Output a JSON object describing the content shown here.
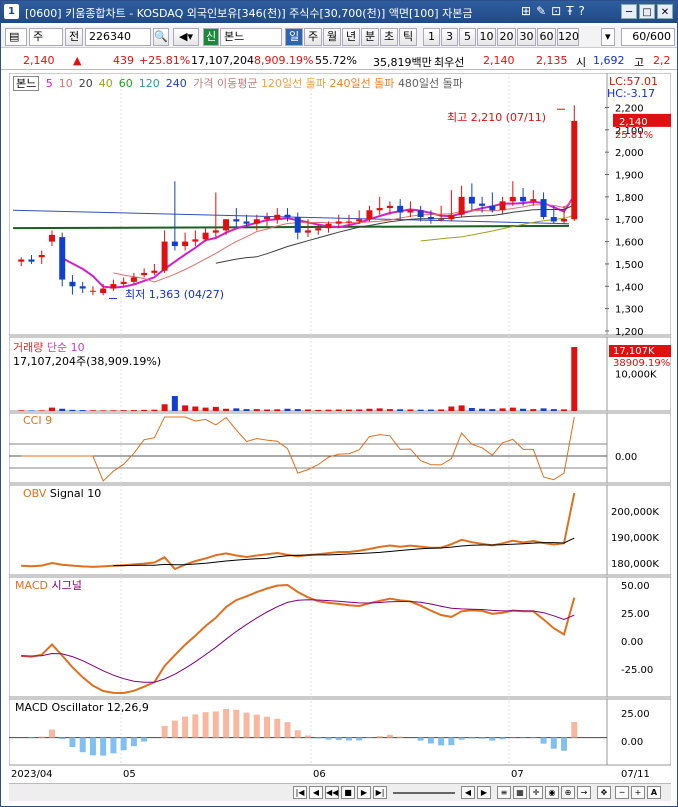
{
  "window": {
    "number": "1",
    "title": "[0600] 키움종합차트 - KOSDAQ 외국인보유[346(천)] 주식수[30,700(천)] 액면[100] 자본금",
    "controls": [
      "□",
      "─",
      "✕"
    ]
  },
  "toolbar": {
    "period_select": "주",
    "prev_label": "전",
    "code": "226340",
    "market_tag": "신",
    "stock_name": "본느",
    "tabs": [
      "일",
      "주",
      "월",
      "년",
      "분",
      "초",
      "틱"
    ],
    "active_tab": "일",
    "numbers": [
      "1",
      "3",
      "5",
      "10",
      "20",
      "30",
      "60",
      "120"
    ],
    "count": "60/600"
  },
  "quote": {
    "price": "2,140",
    "change_arrow": "▲",
    "change": "439",
    "change_pct": "+25.81%",
    "volume": "17,107,204",
    "vol_ratio": "8,909.19%",
    "turnover": "55.72%",
    "amount": "35,819백만",
    "best_label": "최우선",
    "ask": "2,140",
    "bid": "2,135",
    "open_label": "시",
    "open": "1,692",
    "high_label": "고",
    "high": "2,2"
  },
  "price_legend": {
    "name": "본느",
    "ma": [
      {
        "label": "5",
        "color": "#d020d0"
      },
      {
        "label": "10",
        "color": "#e07070"
      },
      {
        "label": "20",
        "color": "#404040"
      },
      {
        "label": "40",
        "color": "#a0a020"
      },
      {
        "label": "60",
        "color": "#20a020"
      },
      {
        "label": "120",
        "color": "#20a0a0"
      },
      {
        "label": "240",
        "color": "#2040c0"
      }
    ],
    "ma_text": "가격 이동평균",
    "break120": "120일선 돌파",
    "break240": "240일선 돌파",
    "break480": "480일선 돌파"
  },
  "price_scale": {
    "lc": "LC:57.01",
    "hc": "HC:-3.17",
    "ticks": [
      "2,200",
      "2,100",
      "2,000",
      "1,900",
      "1,800",
      "1,700",
      "1,600",
      "1,500",
      "1,400",
      "1,300",
      "1,200"
    ],
    "current": "2,140",
    "current_pct": "25.81%",
    "high_note": "최고 2,210 (07/11)",
    "low_note": "최저 1,363 (04/27)"
  },
  "volume_panel": {
    "title": "거래량",
    "sub": "단순 10",
    "value": "17,107,204주(38,909.19%)",
    "tag1": "17,107K",
    "tag2": "38909.19%",
    "tick": "10,000K"
  },
  "cci_panel": {
    "title": "CCI 9",
    "tick": "0.00"
  },
  "obv_panel": {
    "title": "OBV",
    "sub": "Signal 10",
    "ticks": [
      "200,000K",
      "190,000K",
      "180,000K"
    ]
  },
  "macd_panel": {
    "title": "MACD",
    "sub": "시그널",
    "ticks": [
      "50.00",
      "25.00",
      "0.00",
      "-25.00"
    ]
  },
  "osc_panel": {
    "title": "MACD Oscillator 12,26,9",
    "ticks": [
      "25.00",
      "0.00"
    ]
  },
  "x_axis": {
    "labels": [
      "2023/04",
      "05",
      "06",
      "07",
      "07/11"
    ]
  },
  "chart_data": {
    "type": "candlestick",
    "title": "본느",
    "ylim": [
      1200,
      2250
    ],
    "x": [
      "04/20",
      "04/21",
      "04/24",
      "04/25",
      "04/26",
      "04/27",
      "04/28",
      "05/02",
      "05/03",
      "05/04",
      "05/08",
      "05/09",
      "05/10",
      "05/11",
      "05/12",
      "05/15",
      "05/16",
      "05/17",
      "05/18",
      "05/19",
      "05/22",
      "05/23",
      "05/24",
      "05/25",
      "05/26",
      "05/30",
      "05/31",
      "06/01",
      "06/02",
      "06/05",
      "06/07",
      "06/08",
      "06/09",
      "06/12",
      "06/13",
      "06/14",
      "06/15",
      "06/16",
      "06/19",
      "06/20",
      "06/21",
      "06/22",
      "06/23",
      "06/26",
      "06/27",
      "06/28",
      "06/29",
      "06/30",
      "07/03",
      "07/04",
      "07/05",
      "07/06",
      "07/07",
      "07/10",
      "07/11"
    ],
    "open": [
      1510,
      1520,
      1530,
      1600,
      1620,
      1420,
      1400,
      1380,
      1370,
      1390,
      1410,
      1420,
      1450,
      1460,
      1470,
      1600,
      1580,
      1600,
      1610,
      1640,
      1650,
      1700,
      1690,
      1680,
      1700,
      1700,
      1720,
      1710,
      1640,
      1650,
      1660,
      1680,
      1690,
      1690,
      1700,
      1740,
      1750,
      1760,
      1730,
      1740,
      1710,
      1700,
      1700,
      1720,
      1800,
      1770,
      1760,
      1740,
      1780,
      1800,
      1780,
      1790,
      1710,
      1690,
      1700
    ],
    "high": [
      1530,
      1540,
      1560,
      1650,
      1640,
      1450,
      1420,
      1400,
      1410,
      1430,
      1440,
      1460,
      1480,
      1500,
      1650,
      1870,
      1640,
      1650,
      1660,
      1820,
      1700,
      1750,
      1720,
      1720,
      1730,
      1750,
      1750,
      1730,
      1700,
      1680,
      1690,
      1720,
      1720,
      1740,
      1760,
      1800,
      1780,
      1790,
      1780,
      1760,
      1740,
      1760,
      1830,
      1850,
      1860,
      1800,
      1820,
      1800,
      1870,
      1840,
      1830,
      1820,
      1760,
      1760,
      2210
    ],
    "low": [
      1490,
      1500,
      1500,
      1580,
      1400,
      1363,
      1370,
      1360,
      1360,
      1380,
      1400,
      1410,
      1440,
      1450,
      1460,
      1560,
      1560,
      1580,
      1600,
      1620,
      1630,
      1660,
      1660,
      1650,
      1670,
      1680,
      1690,
      1610,
      1620,
      1630,
      1640,
      1660,
      1670,
      1680,
      1690,
      1720,
      1720,
      1700,
      1710,
      1690,
      1680,
      1690,
      1690,
      1710,
      1740,
      1730,
      1730,
      1720,
      1760,
      1760,
      1760,
      1700,
      1680,
      1680,
      1692
    ],
    "close": [
      1520,
      1510,
      1540,
      1630,
      1430,
      1400,
      1390,
      1380,
      1390,
      1410,
      1420,
      1440,
      1460,
      1470,
      1600,
      1580,
      1600,
      1610,
      1640,
      1650,
      1700,
      1690,
      1680,
      1700,
      1710,
      1720,
      1710,
      1640,
      1650,
      1660,
      1680,
      1690,
      1690,
      1700,
      1740,
      1750,
      1760,
      1730,
      1740,
      1710,
      1700,
      1700,
      1720,
      1800,
      1770,
      1760,
      1740,
      1780,
      1800,
      1780,
      1790,
      1710,
      1690,
      1701,
      2140
    ],
    "volume_k": [
      200,
      150,
      180,
      900,
      600,
      300,
      250,
      200,
      180,
      200,
      220,
      250,
      300,
      350,
      1800,
      4000,
      1500,
      1200,
      900,
      1100,
      600,
      700,
      500,
      500,
      400,
      450,
      600,
      500,
      400,
      300,
      350,
      400,
      380,
      420,
      600,
      700,
      500,
      450,
      400,
      350,
      380,
      420,
      1200,
      1500,
      800,
      600,
      500,
      700,
      900,
      600,
      500,
      700,
      500,
      440,
      17107
    ],
    "volume_colors": "up_red_down_blue"
  }
}
